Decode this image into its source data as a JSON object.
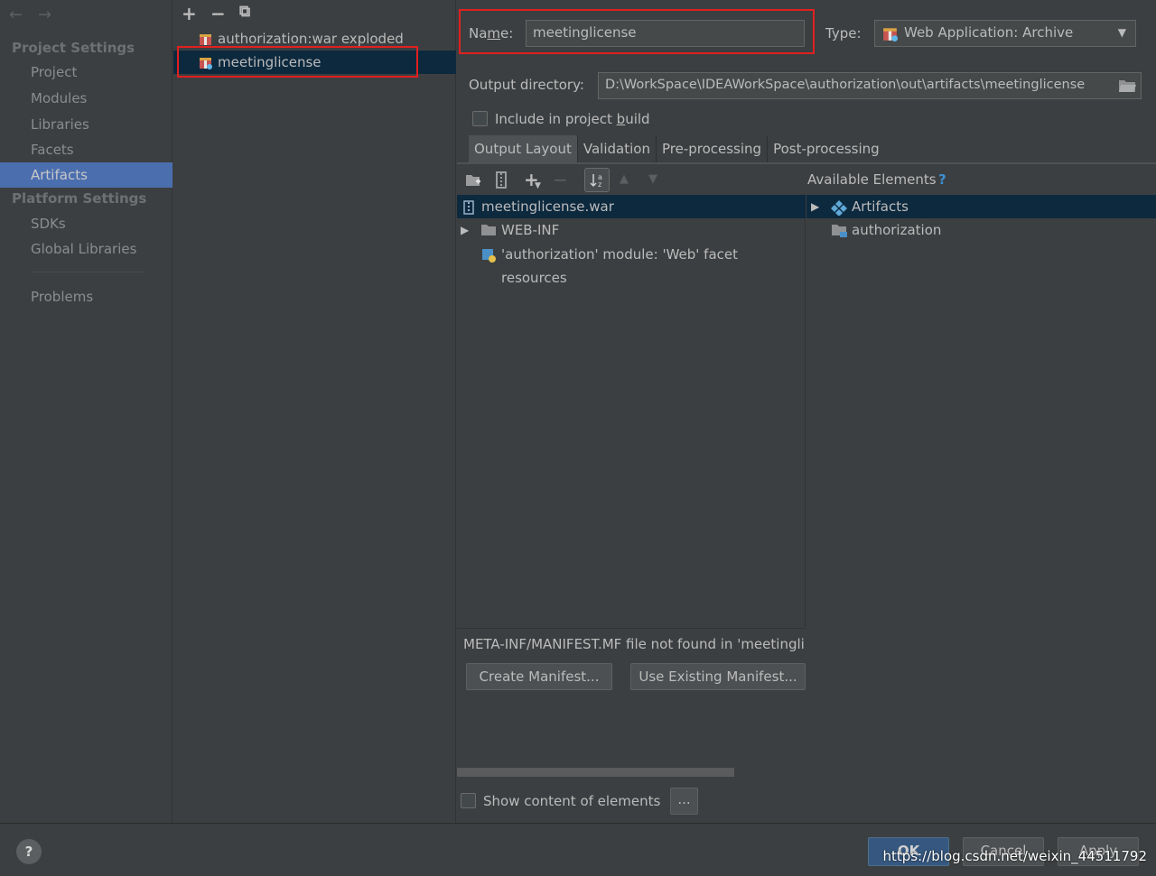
{
  "nav": {
    "back": "←",
    "forward": "→"
  },
  "sidebar": {
    "project_settings_title": "Project Settings",
    "project_items": [
      "Project",
      "Modules",
      "Libraries",
      "Facets",
      "Artifacts"
    ],
    "platform_settings_title": "Platform Settings",
    "platform_items": [
      "SDKs",
      "Global Libraries"
    ],
    "problems": "Problems",
    "selected": "Artifacts"
  },
  "artifact_toolbar": {
    "add": "+",
    "remove": "−",
    "copy": "⧉"
  },
  "artifacts": [
    {
      "label": "authorization:war exploded",
      "icon": "artifact-war-exploded-icon"
    },
    {
      "label": "meetinglicense",
      "icon": "artifact-war-icon"
    }
  ],
  "form": {
    "name_label": "Name:",
    "name_label_parts": [
      "Na",
      "m",
      "e:"
    ],
    "name_value": "meetinglicense",
    "type_label": "Type:",
    "type_value": "Web Application: Archive",
    "output_dir_label": "Output directory:",
    "output_dir_value": "D:\\WorkSpace\\IDEAWorkSpace\\authorization\\out\\artifacts\\meetinglicense",
    "include_label_parts": [
      "Include in project ",
      "b",
      "uild"
    ],
    "include_checked": false
  },
  "tabs": [
    "Output Layout",
    "Validation",
    "Pre-processing",
    "Post-processing"
  ],
  "active_tab": "Output Layout",
  "layout_tree": [
    {
      "label": "meetinglicense.war",
      "icon": "archive-icon",
      "expander": ""
    },
    {
      "label": "WEB-INF",
      "icon": "folder-icon",
      "expander": "▶"
    },
    {
      "label": "'authorization' module: 'Web' facet resources",
      "icon": "web-facet-icon",
      "expander": ""
    }
  ],
  "available": {
    "title": "Available Elements",
    "help": "?",
    "items": [
      {
        "label": "Artifacts",
        "icon": "artifacts-icon",
        "expander": "▶"
      },
      {
        "label": "authorization",
        "icon": "module-folder-icon",
        "expander": ""
      }
    ]
  },
  "manifest": {
    "message": "META-INF/MANIFEST.MF file not found in 'meetingli",
    "create_button": "Create Manifest...",
    "existing_button": "Use Existing Manifest..."
  },
  "show_content": {
    "label": "Show content of elements",
    "ellipsis": "...",
    "checked": false
  },
  "footer": {
    "help": "?",
    "ok": "OK",
    "cancel": "Cancel",
    "apply": "Apply",
    "watermark": "https://blog.csdn.net/weixin_44511792"
  },
  "colors": {
    "selection_blue": "#4b6eaf",
    "tree_selection": "#0d293e",
    "highlight_red": "#e02020"
  }
}
